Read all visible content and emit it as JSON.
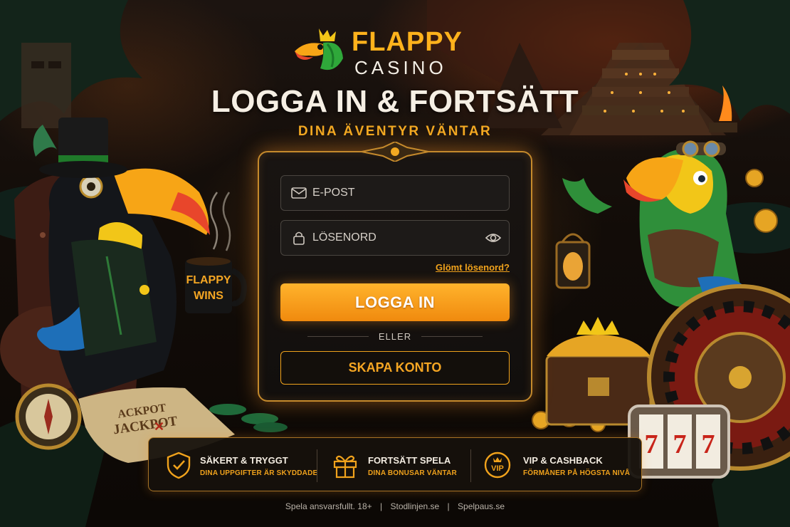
{
  "brand": {
    "name": "FLAPPY",
    "sub": "CASINO"
  },
  "headline": "LOGGA IN & FORTSÄTT",
  "subheadline": "DINA ÄVENTYR VÄNTAR",
  "login": {
    "email_placeholder": "E-POST",
    "password_placeholder": "LÖSENORD",
    "forgot_label": "Glömt lösenord?",
    "login_label": "LOGGA IN",
    "or_label": "ELLER",
    "create_label": "SKAPA KONTO"
  },
  "features": [
    {
      "title": "SÄKERT & TRYGGT",
      "subtitle": "DINA UPPGIFTER ÄR SKYDDADE",
      "icon": "shield-check-icon"
    },
    {
      "title": "FORTSÄTT SPELA",
      "subtitle": "DINA BONUSAR VÄNTAR",
      "icon": "gift-icon"
    },
    {
      "title": "VIP & CASHBACK",
      "subtitle": "FÖRMÅNER PÅ HÖGSTA NIVÅ",
      "icon": "vip-icon"
    }
  ],
  "mug_text": "FLAPPY WINS",
  "map_text": [
    "ACKPOT",
    "JACKPOT"
  ],
  "footer": {
    "responsible": "Spela ansvarsfullt. 18+",
    "link1": "Stodlinjen.se",
    "link2": "Spelpaus.se",
    "divider": "|"
  },
  "colors": {
    "accent": "#f5a623",
    "button_top": "#ffb32c",
    "button_bottom": "#f08a0e",
    "panel_border": "#c58a2c"
  }
}
